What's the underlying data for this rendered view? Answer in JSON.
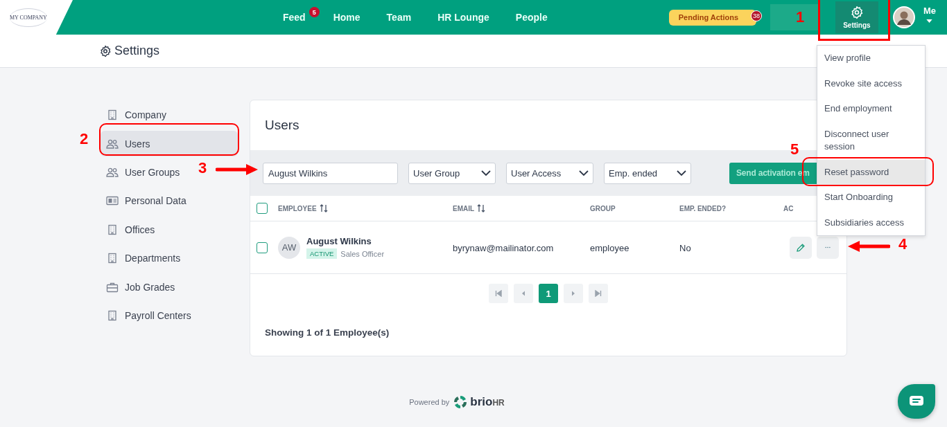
{
  "top_bar": {
    "logo": "MY COMPANY",
    "nav": [
      {
        "label": "Feed",
        "badge": "5"
      },
      {
        "label": "Home"
      },
      {
        "label": "Team"
      },
      {
        "label": "HR Lounge"
      },
      {
        "label": "People"
      }
    ],
    "pending_actions": {
      "label": "Pending Actions",
      "badge": "38"
    },
    "settings_button": {
      "label": "Settings",
      "selected": true
    },
    "user": {
      "label": "Me"
    }
  },
  "page_header": {
    "title": "Settings"
  },
  "sidebar": {
    "items": [
      {
        "label": "Company",
        "kind": "building",
        "selected": false
      },
      {
        "label": "Users",
        "kind": "people",
        "selected": true
      },
      {
        "label": "User Groups",
        "kind": "people",
        "selected": false
      },
      {
        "label": "Personal Data",
        "kind": "card",
        "selected": false
      },
      {
        "label": "Offices",
        "kind": "building",
        "selected": false
      },
      {
        "label": "Departments",
        "kind": "building",
        "selected": false
      },
      {
        "label": "Job Grades",
        "kind": "briefcase",
        "selected": false
      },
      {
        "label": "Payroll Centers",
        "kind": "building",
        "selected": false
      }
    ]
  },
  "users_card": {
    "title": "Users",
    "search": {
      "value": "August Wilkins"
    },
    "filters": [
      "User Group",
      "User Access",
      "Emp. ended"
    ],
    "send_button": "Send activation em",
    "table": {
      "all_checked": false,
      "columns": [
        {
          "label": "EMPLOYEE",
          "sortable": true
        },
        {
          "label": "EMAIL",
          "sortable": true
        },
        {
          "label": "GROUP",
          "sortable": false
        },
        {
          "label": "EMP. ENDED?",
          "sortable": false
        },
        {
          "label": "AC",
          "sortable": false
        }
      ],
      "rows": [
        {
          "checked": false,
          "initials": "AW",
          "name": "August Wilkins",
          "status": "ACTIVE",
          "role": "Sales Officer",
          "email": "byrynaw@mailinator.com",
          "group": "employee",
          "emp_ended": "No"
        }
      ]
    },
    "pagination": {
      "pages": [
        {
          "label": "1",
          "selected": true
        }
      ]
    },
    "summary": "Showing 1 of 1 Employee(s)"
  },
  "action_menu": {
    "items": [
      {
        "label": "View profile",
        "highlighted": false
      },
      {
        "label": "Revoke site access",
        "highlighted": false
      },
      {
        "label": "End employment",
        "highlighted": false
      },
      {
        "label": "Disconnect user session",
        "highlighted": false
      },
      {
        "label": "Reset password",
        "highlighted": true
      },
      {
        "label": "Start Onboarding",
        "highlighted": false
      },
      {
        "label": "Subsidiaries access",
        "highlighted": false
      }
    ]
  },
  "annotations": [
    "1",
    "2",
    "3",
    "4",
    "5"
  ],
  "footer": {
    "powered_by": "Powered by",
    "brand": "brio",
    "brand_suffix": "HR"
  }
}
